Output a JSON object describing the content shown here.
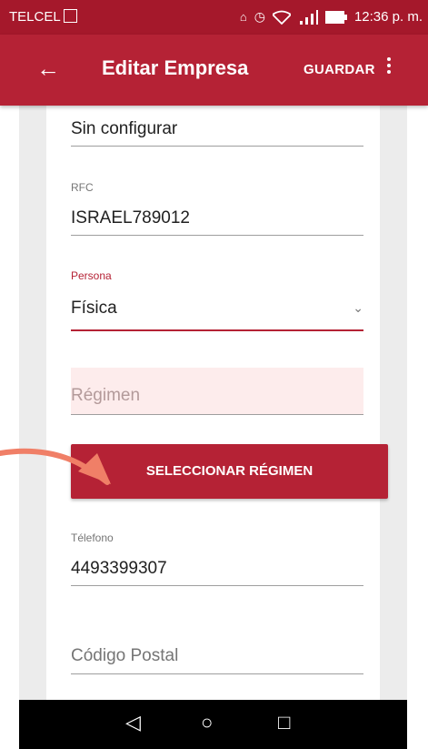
{
  "status_bar": {
    "carrier": "TELCEL",
    "icons": [
      "image-icon",
      "vibrate-icon",
      "alarm-icon",
      "wifi-icon",
      "signal-icon",
      "battery-icon"
    ],
    "time": "12:36 p. m."
  },
  "app_bar": {
    "back_icon": "arrow-left-icon",
    "title": "Editar Empresa",
    "save_label": "GUARDAR",
    "menu_icon": "more-vert-icon"
  },
  "form": {
    "config_value": "Sin configurar",
    "rfc": {
      "label": "RFC",
      "value": "ISRAEL789012"
    },
    "persona": {
      "label": "Persona",
      "value": "Física"
    },
    "regimen": {
      "placeholder": "Régimen"
    },
    "select_button": "SELECCIONAR RÉGIMEN",
    "telefono": {
      "label": "Télefono",
      "value": "4493399307"
    },
    "codigo_postal": {
      "placeholder": "Código Postal"
    }
  },
  "nav_bar": {
    "back": "◁",
    "home": "○",
    "recent": "□"
  },
  "colors": {
    "primary": "#b52235",
    "status_bar": "#a5182b",
    "error_highlight": "#fdecec",
    "annotation_arrow": "#f07f67"
  }
}
